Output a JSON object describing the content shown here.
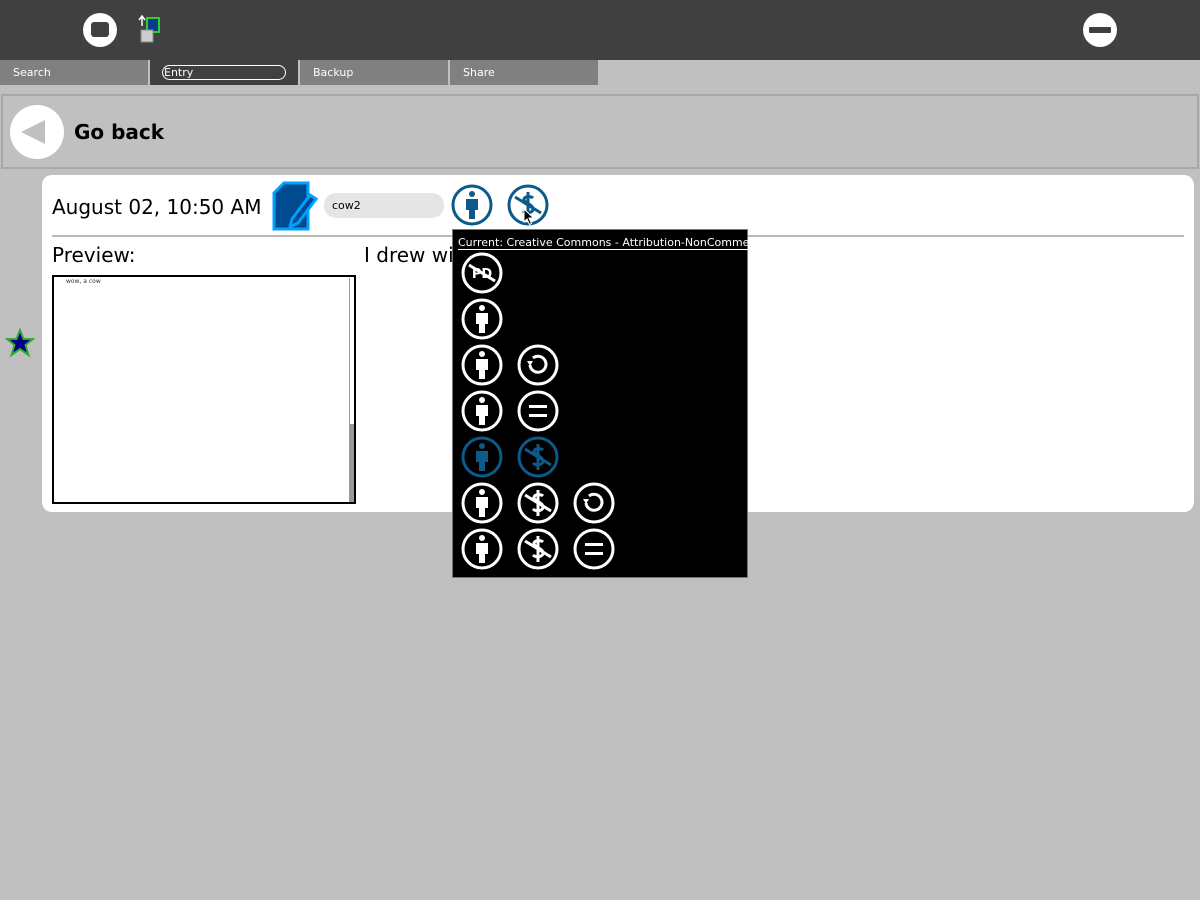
{
  "toolbar": {
    "journal_icon": "journal-icon",
    "import_icon": "import-icon",
    "stop_icon": "stop-icon"
  },
  "tabs": [
    {
      "label": "Search",
      "active": false
    },
    {
      "label": "Entry",
      "active": true
    },
    {
      "label": "Backup",
      "active": false
    },
    {
      "label": "Share",
      "active": false
    }
  ],
  "back": {
    "label": "Go back"
  },
  "entry": {
    "date": "August 02, 10:50 AM",
    "title": "cow2",
    "preview_label": "Preview:",
    "description": "I drew wi",
    "preview_text": "wow, a cow",
    "favorite_icon": "star-icon",
    "license_icons": [
      "attribution-icon",
      "noncommercial-icon"
    ]
  },
  "license_menu": {
    "current": "Current: Creative Commons - Attribution-NonCommercial",
    "options": [
      {
        "name": "public-domain",
        "icons": [
          "public-domain-icon"
        ],
        "selected": false
      },
      {
        "name": "by",
        "icons": [
          "attribution-icon"
        ],
        "selected": false
      },
      {
        "name": "by-sa",
        "icons": [
          "attribution-icon",
          "share-alike-icon"
        ],
        "selected": false
      },
      {
        "name": "by-nd",
        "icons": [
          "attribution-icon",
          "no-derivatives-icon"
        ],
        "selected": false
      },
      {
        "name": "by-nc",
        "icons": [
          "attribution-icon",
          "noncommercial-icon"
        ],
        "selected": true
      },
      {
        "name": "by-nc-sa",
        "icons": [
          "attribution-icon",
          "noncommercial-icon",
          "share-alike-icon"
        ],
        "selected": false
      },
      {
        "name": "by-nc-nd",
        "icons": [
          "attribution-icon",
          "noncommercial-icon",
          "no-derivatives-icon"
        ],
        "selected": false
      }
    ]
  },
  "colors": {
    "toolbar": "#404040",
    "tab_inactive": "#808080",
    "background": "#c0c0c0",
    "license_selected": "#0b5a8a",
    "edit_icon_fill": "#004a8f",
    "edit_icon_stroke": "#00a0ff",
    "star_fill": "#000080",
    "star_stroke": "#33aa33"
  }
}
